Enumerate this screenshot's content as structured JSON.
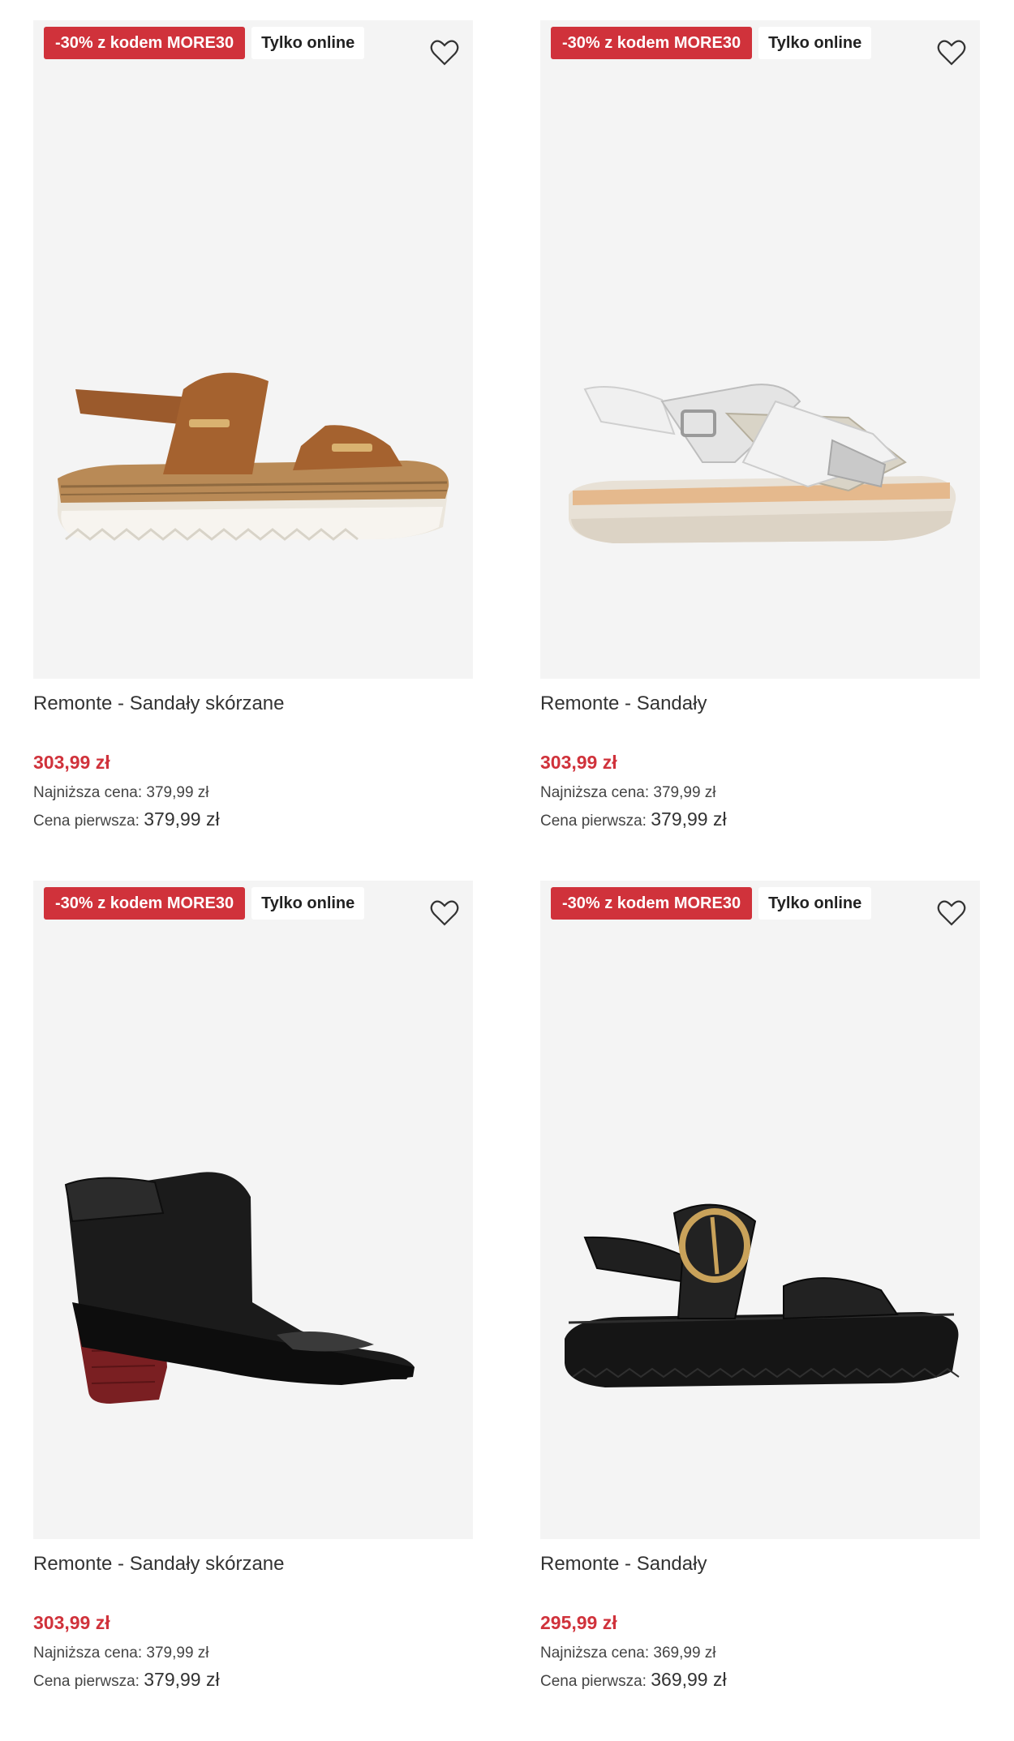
{
  "products": [
    {
      "promo_badge": "-30% z kodem MORE30",
      "online_badge": "Tylko online",
      "name": "Remonte - Sandały skórzane",
      "price": "303,99 zł",
      "lowest_label": "Najniższa cena:",
      "lowest_value": "379,99 zł",
      "first_label": "Cena pierwsza:",
      "first_value": "379,99 zł",
      "image": "brown-platform-sandal-image"
    },
    {
      "promo_badge": "-30% z kodem MORE30",
      "online_badge": "Tylko online",
      "name": "Remonte - Sandały",
      "price": "303,99 zł",
      "lowest_label": "Najniższa cena:",
      "lowest_value": "379,99 zł",
      "first_label": "Cena pierwsza:",
      "first_value": "379,99 zł",
      "image": "silver-white-strappy-sandal-image"
    },
    {
      "promo_badge": "-30% z kodem MORE30",
      "online_badge": "Tylko online",
      "name": "Remonte - Sandały skórzane",
      "price": "303,99 zł",
      "lowest_label": "Najniższa cena:",
      "lowest_value": "379,99 zł",
      "first_label": "Cena pierwsza:",
      "first_value": "379,99 zł",
      "image": "black-heeled-peep-toe-bootie-image"
    },
    {
      "promo_badge": "-30% z kodem MORE30",
      "online_badge": "Tylko online",
      "name": "Remonte - Sandały",
      "price": "295,99 zł",
      "lowest_label": "Najniższa cena:",
      "lowest_value": "369,99 zł",
      "first_label": "Cena pierwsza:",
      "first_value": "369,99 zł",
      "image": "black-buckle-platform-sandal-image"
    }
  ],
  "colors": {
    "promo_badge_bg": "#d0323b",
    "price": "#d0323b",
    "image_bg": "#f4f4f4"
  }
}
